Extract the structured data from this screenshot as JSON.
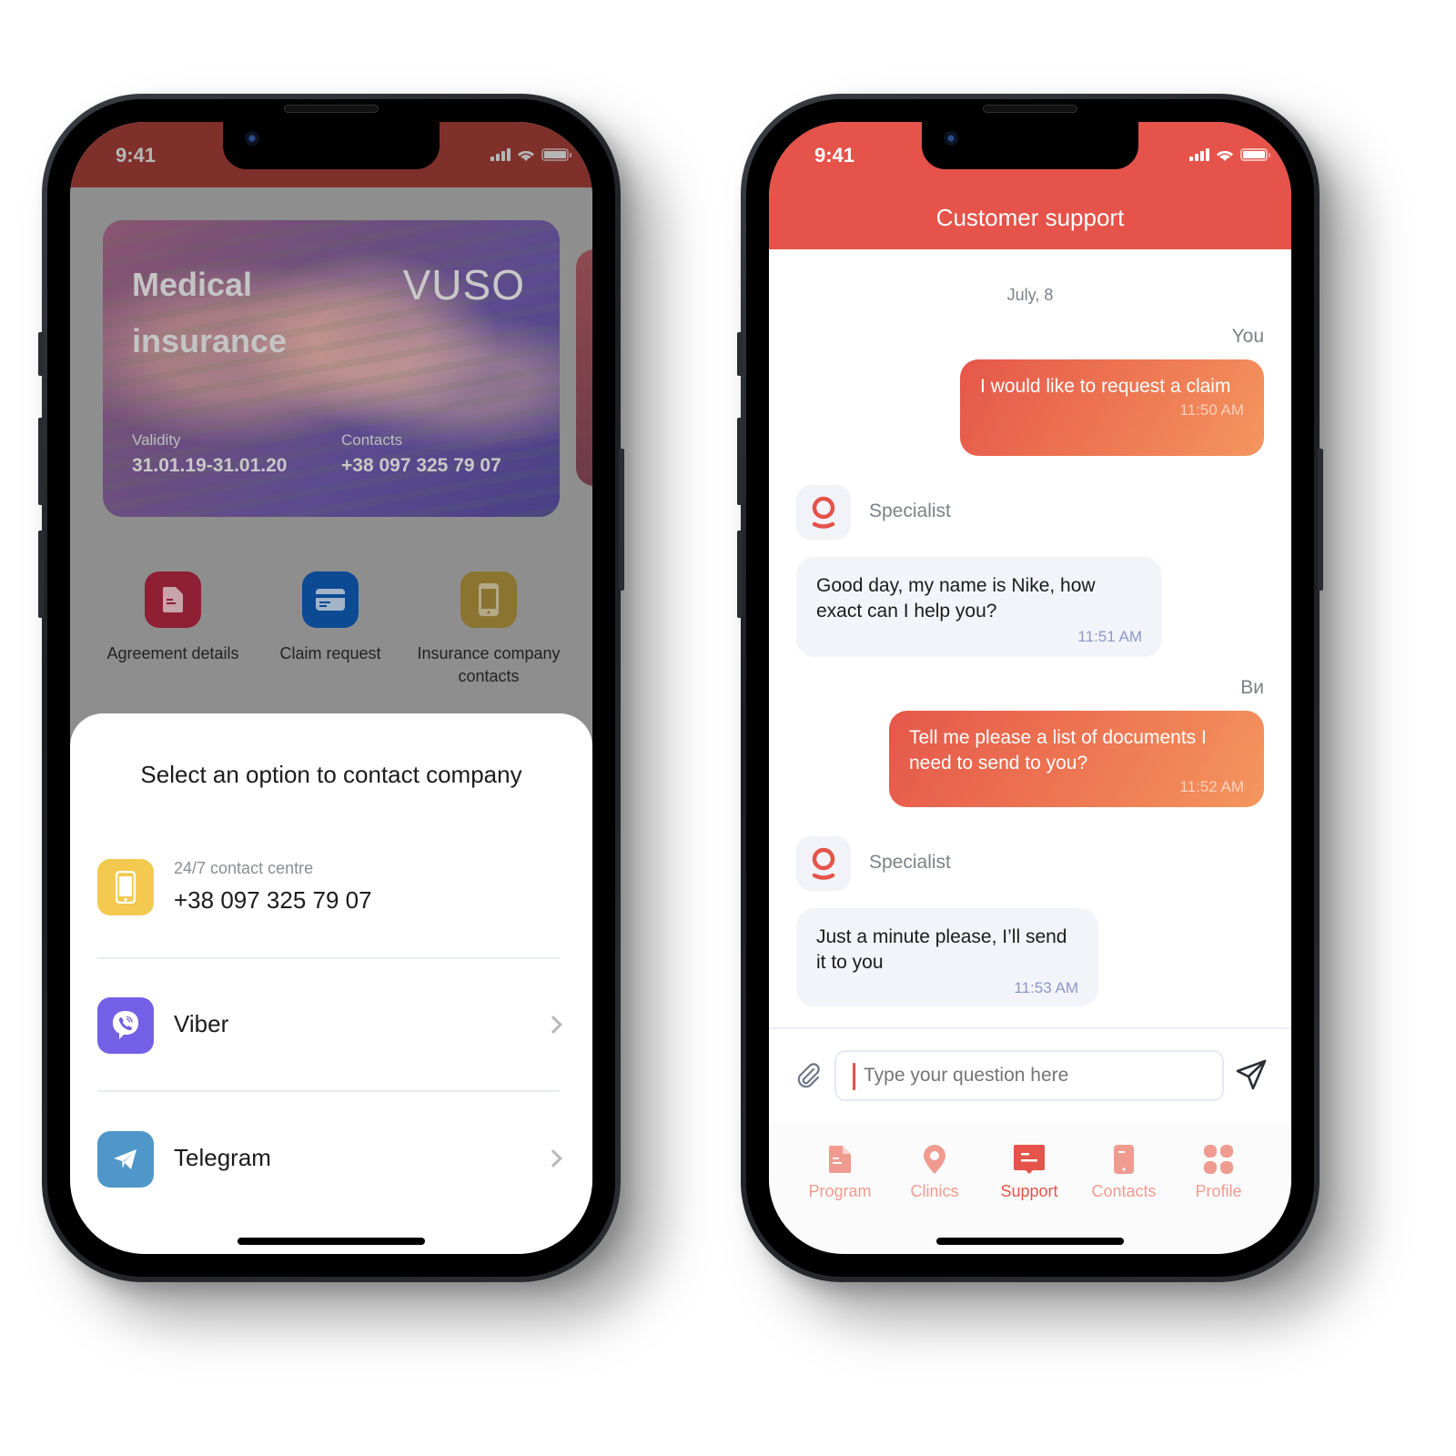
{
  "left_phone": {
    "status_bar": {
      "time": "9:41"
    },
    "policy_card": {
      "title": "Medical\ninsurance",
      "brand": "VUSO",
      "validity_label": "Validity",
      "validity_value": "31.01.19-31.01.20",
      "contacts_label": "Contacts",
      "contacts_value": "+38 097 325 79 07"
    },
    "quick_actions": [
      {
        "label": "Agreement details",
        "icon": "document-icon",
        "color": "#8f1f33"
      },
      {
        "label": "Claim request",
        "icon": "card-icon",
        "color": "#0c4a94"
      },
      {
        "label": "Insurance company contacts",
        "icon": "phone-icon",
        "color": "#8a7430"
      }
    ],
    "contact_sheet": {
      "title": "Select an option to contact company",
      "phone_option": {
        "subtitle": "24/7 contact centre",
        "value": "+38 097 325 79 07",
        "icon": "phone-icon",
        "color": "#f3c94f"
      },
      "options": [
        {
          "label": "Viber",
          "icon": "viber-icon",
          "color": "#7360e6"
        },
        {
          "label": "Telegram",
          "icon": "telegram-icon",
          "color": "#4f97c9"
        }
      ]
    }
  },
  "right_phone": {
    "status_bar": {
      "time": "9:41"
    },
    "header": {
      "title": "Customer support"
    },
    "chat": {
      "date": "July, 8",
      "messages": [
        {
          "direction": "out",
          "sender": "You",
          "text": "I would like to request a claim",
          "time": "11:50 AM"
        },
        {
          "direction": "in",
          "sender": "Specialist",
          "text": "Good day, my name is Nike, how exact can I help you?",
          "time": "11:51 AM"
        },
        {
          "direction": "out",
          "sender": "Ви",
          "text": "Tell me please a list of documents I need to send to you?",
          "time": "11:52 AM"
        },
        {
          "direction": "in",
          "sender": "Specialist",
          "text": "Just a minute please, I’ll send it to you",
          "time": "11:53 AM"
        }
      ]
    },
    "composer": {
      "placeholder": "Type your question here",
      "value": ""
    },
    "tabbar": {
      "active": "Support",
      "items": [
        {
          "label": "Program",
          "icon": "document-icon"
        },
        {
          "label": "Clinics",
          "icon": "location-pin-icon"
        },
        {
          "label": "Support",
          "icon": "chat-icon"
        },
        {
          "label": "Contacts",
          "icon": "phone-icon"
        },
        {
          "label": "Profile",
          "icon": "grid-icon"
        }
      ]
    },
    "colors": {
      "accent": "#e5534a",
      "accent_light": "#f09b90",
      "bubble_in": "#f3f4f9"
    }
  }
}
